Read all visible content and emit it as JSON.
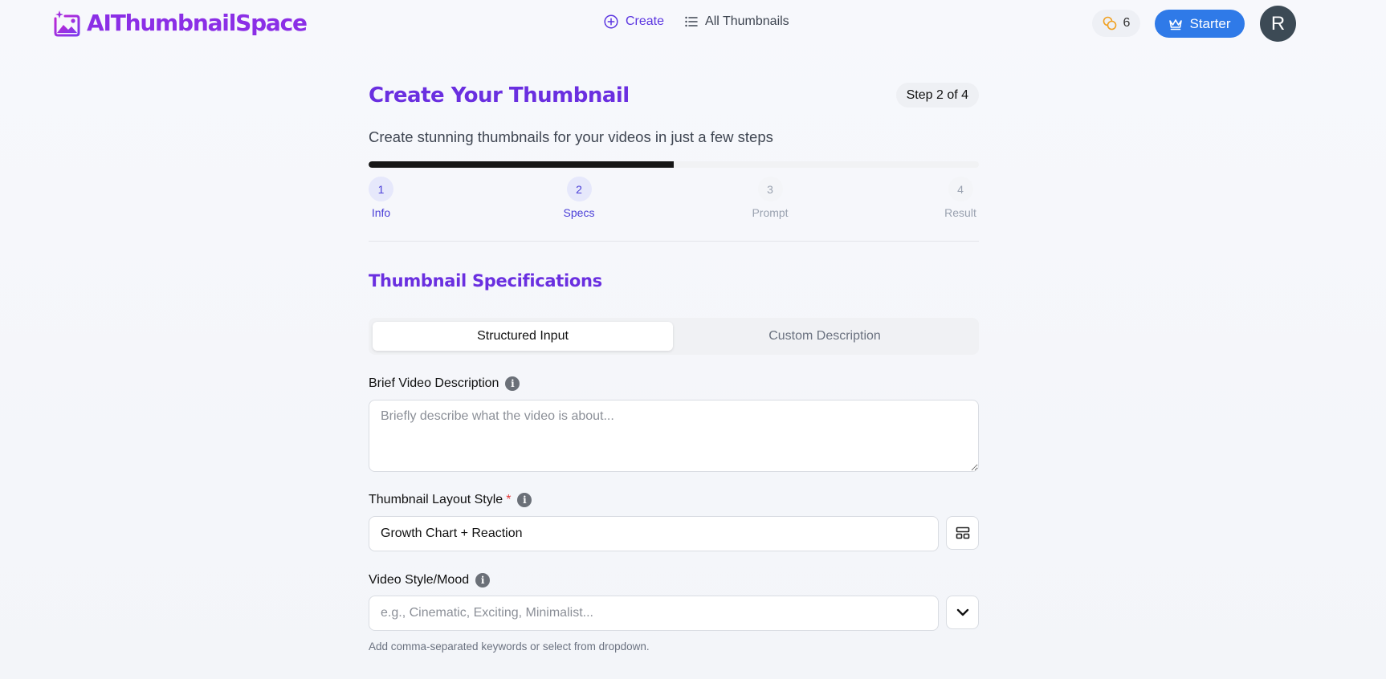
{
  "header": {
    "brand": "AIThumbnailSpace",
    "nav": {
      "create_label": "Create",
      "all_thumbnails_label": "All Thumbnails"
    },
    "credits": "6",
    "plan_label": "Starter",
    "avatar_initial": "R"
  },
  "main": {
    "title": "Create Your Thumbnail",
    "step_badge": "Step 2 of 4",
    "subtitle": "Create stunning thumbnails for your videos in just a few steps",
    "progress_fraction": 0.5,
    "steps": [
      {
        "number": "1",
        "label": "Info"
      },
      {
        "number": "2",
        "label": "Specs"
      },
      {
        "number": "3",
        "label": "Prompt"
      },
      {
        "number": "4",
        "label": "Result"
      }
    ],
    "section_title": "Thumbnail Specifications",
    "tabs": {
      "structured": "Structured Input",
      "custom": "Custom Description"
    },
    "fields": {
      "description": {
        "label": "Brief Video Description",
        "placeholder": "Briefly describe what the video is about..."
      },
      "layout": {
        "label": "Thumbnail Layout Style",
        "required_mark": "*",
        "value": "Growth Chart + Reaction"
      },
      "mood": {
        "label": "Video Style/Mood",
        "placeholder": "e.g., Cinematic, Exciting, Minimalist...",
        "helper": "Add comma-separated keywords or select from dropdown."
      }
    }
  },
  "colors": {
    "brand_purple": "#8b2fe6",
    "title_purple": "#6a2fe0",
    "accent_blue": "#2f7ae8",
    "progress_fill": "#161616",
    "required_red": "#e23b3b"
  }
}
